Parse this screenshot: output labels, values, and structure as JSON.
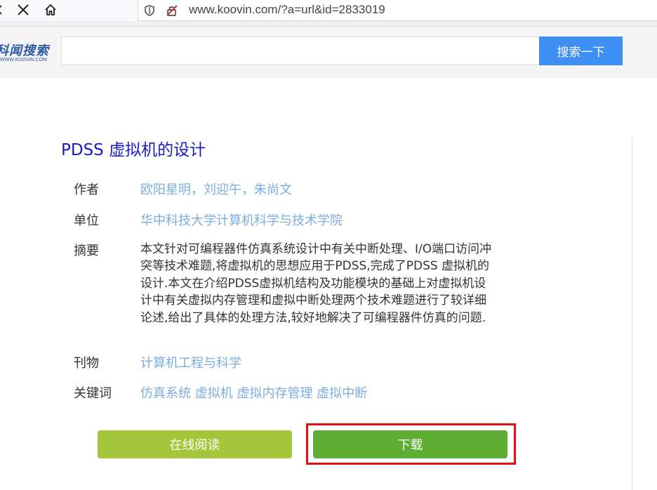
{
  "browser": {
    "url_text": "www.koovin.com/?a=url&id=2833019"
  },
  "site": {
    "logo_main": "科闻搜索",
    "logo_sub": "WWW.KOOVIN.COM",
    "search_value": "",
    "search_button_label": "搜索一下"
  },
  "paper": {
    "title": "PDSS 虚拟机的设计",
    "fields": {
      "author_label": "作者",
      "author_value": "欧阳星明，刘迎午，朱尚文",
      "org_label": "单位",
      "org_value": "华中科技大学计算机科学与技术学院",
      "abstract_label": "摘要",
      "abstract_lines": [
        "本文针对可编程器件仿真系统设计中有关中断处理、I/O端口访问冲",
        "突等技术难题,将虚拟机的思想应用于PDSS,完成了PDSS 虚拟机的",
        "设计.本文在介绍PDSS虚拟机结构及功能模块的基础上对虚拟机设",
        "计中有关虚拟内存管理和虚拟中断处理两个技术难题进行了较详细",
        "论述,给出了具体的处理方法,较好地解决了可编程器件仿真的问题."
      ],
      "journal_label": "刊物",
      "journal_value": "计算机工程与科学",
      "keywords_label": "关键词",
      "keywords_value": "仿真系统 虚拟机 虚拟内存管理 虚拟中断"
    }
  },
  "actions": {
    "read_online_label": "在线阅读",
    "download_label": "下载"
  },
  "colors": {
    "title": "#1a1acc",
    "link": "#7aaee0",
    "search_button": "#3d8ff4",
    "read_button": "#a5c63a",
    "download_button": "#5eae33",
    "highlight": "#e01010"
  }
}
